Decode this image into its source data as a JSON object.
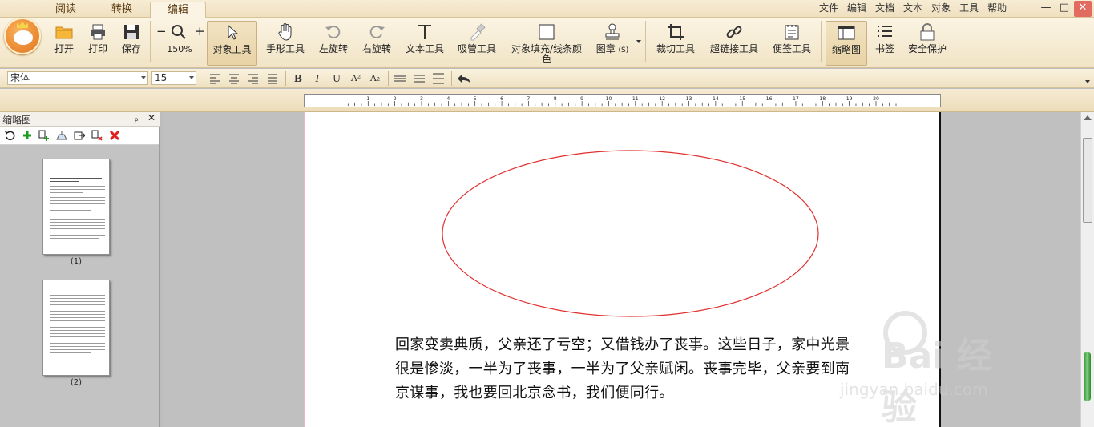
{
  "tabs": [
    "阅读",
    "转换",
    "编辑"
  ],
  "menu": [
    "文件",
    "编辑",
    "文档",
    "文本",
    "对象",
    "工具",
    "帮助"
  ],
  "window_controls": {
    "minimize": "—",
    "maximize": "□",
    "close": "✕"
  },
  "ribbon": {
    "open": "打开",
    "print": "打印",
    "save": "保存",
    "zoom": "150%",
    "zoom_out": "−",
    "zoom_in": "+",
    "object_tool": "对象工具",
    "hand_tool": "手形工具",
    "rotate_left": "左旋转",
    "rotate_right": "右旋转",
    "text_tool": "文本工具",
    "eyedropper": "吸管工具",
    "fill_color_line1": "对象填充/线条颜",
    "fill_color_line2": "色",
    "stamp": "图章",
    "stamp_shortcut": "(S)",
    "crop": "裁切工具",
    "hyperlink": "超链接工具",
    "note": "便签工具",
    "thumbnail": "缩略图",
    "bookmark": "书签",
    "security": "安全保护"
  },
  "format": {
    "font": "宋体",
    "size": "15",
    "bold": "B",
    "italic": "I",
    "underline": "U",
    "superscript": "A²",
    "subscript": "A₂"
  },
  "ruler_labels": [
    "1",
    "2",
    "3",
    "4",
    "5",
    "6",
    "7",
    "8",
    "9",
    "10",
    "11",
    "12",
    "13",
    "14",
    "15",
    "16",
    "17",
    "18",
    "19",
    "20"
  ],
  "thumb_panel": {
    "title": "缩略图",
    "pin": "ₚ",
    "close": "✕",
    "pages": [
      "(1)",
      "(2)"
    ]
  },
  "document": {
    "lines": [
      "回家变卖典质，父亲还了亏空；又借钱办了丧事。这些日子，家中光景",
      "很是惨淡，一半为了丧事，一半为了父亲赋闲。丧事完毕，父亲要到南",
      "京谋事，我也要回北京念书，我们便同行。"
    ],
    "ellipse_color": "#e0312f"
  },
  "watermark": {
    "brand": "Bai 经验",
    "url": "jingyan.baidu.com"
  },
  "colors": {
    "accent": "#e0731c",
    "ribbon_bg": "#f1e4c6"
  }
}
